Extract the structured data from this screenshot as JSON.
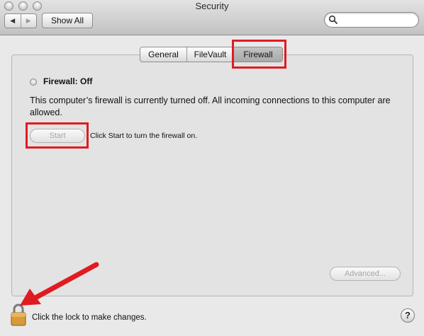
{
  "window": {
    "title": "Security"
  },
  "toolbar": {
    "back_icon": "back-arrow-icon",
    "forward_icon": "forward-arrow-icon",
    "show_all_label": "Show All",
    "search": {
      "icon": "search-icon",
      "value": "",
      "placeholder": ""
    }
  },
  "tabs": [
    {
      "label": "General"
    },
    {
      "label": "FileVault"
    },
    {
      "label": "Firewall",
      "selected": true
    }
  ],
  "firewall": {
    "status_title": "Firewall: Off",
    "description": "This computer’s firewall is currently turned off. All incoming connections to this computer are allowed.",
    "start_button": "Start",
    "start_hint": "Click Start to turn the firewall on.",
    "advanced_button": "Advanced..."
  },
  "footer": {
    "lock_icon": "lock-icon",
    "lock_text": "Click the lock to make changes.",
    "help_label": "?"
  },
  "colors": {
    "highlight": "#e01b22",
    "annotation_arrow": "#e01b22",
    "window_background": "#e9e9e9"
  }
}
